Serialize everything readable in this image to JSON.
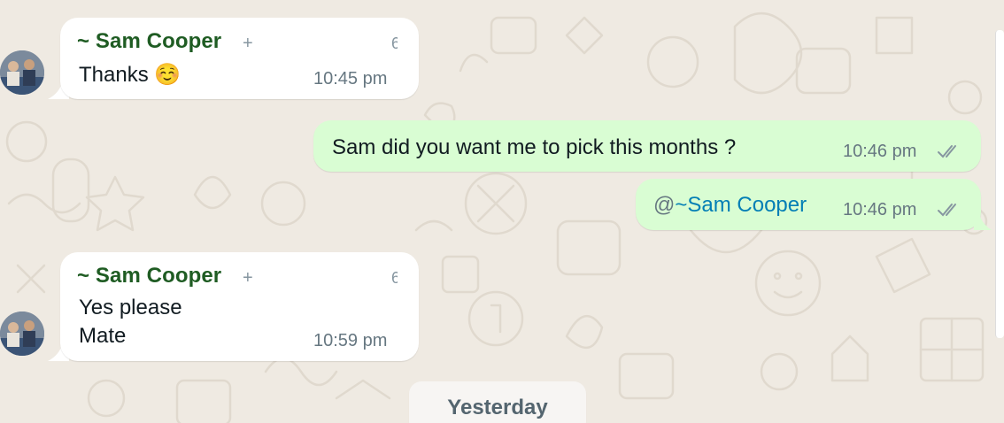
{
  "messages": [
    {
      "direction": "in",
      "sender": "~ Sam Cooper",
      "sender_badge": "+",
      "truncated_mark": "6",
      "text": "Thanks ☺️",
      "time": "10:45 pm"
    },
    {
      "direction": "out",
      "text": "Sam did you want me to pick this months ?",
      "time": "10:46 pm",
      "ticks": "read"
    },
    {
      "direction": "out",
      "mention_at": "@",
      "mention_name": "~Sam Cooper",
      "time": "10:46 pm",
      "ticks": "read"
    },
    {
      "direction": "in",
      "sender": "~ Sam Cooper",
      "sender_badge": "+",
      "truncated_mark": "6",
      "text_lines": [
        "Yes please",
        "Mate"
      ],
      "time": "10:59 pm"
    }
  ],
  "date_divider": "Yesterday",
  "colors": {
    "background": "#efeae2",
    "incoming_bubble": "#ffffff",
    "outgoing_bubble": "#d9fdd3",
    "sender_name": "#1f5c23",
    "mention": "#027eb5",
    "tick": "#8696a0"
  }
}
